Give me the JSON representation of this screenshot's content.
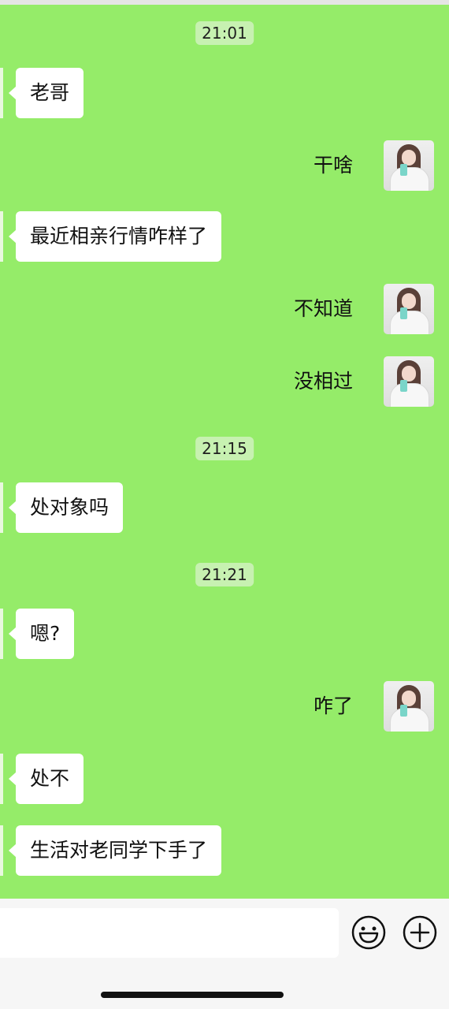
{
  "timestamps": [
    "21:01",
    "21:15",
    "21:21"
  ],
  "messages": [
    {
      "side": "left",
      "text": "老哥"
    },
    {
      "side": "right",
      "text": "干啥"
    },
    {
      "side": "left",
      "text": "最近相亲行情咋样了"
    },
    {
      "side": "right",
      "text": "不知道"
    },
    {
      "side": "right",
      "text": "没相过"
    },
    {
      "side": "left",
      "text": "处对象吗"
    },
    {
      "side": "left",
      "text": "嗯?"
    },
    {
      "side": "right",
      "text": "咋了"
    },
    {
      "side": "left",
      "text": "处不"
    },
    {
      "side": "left",
      "text": "生活对老同学下手了"
    }
  ],
  "input_bar": {
    "icons": [
      "emoji-icon",
      "plus-icon"
    ]
  },
  "colors": {
    "chat_background": "#95ec69",
    "bubble": "#ffffff",
    "timestamp_badge": "#c7f1b1"
  }
}
